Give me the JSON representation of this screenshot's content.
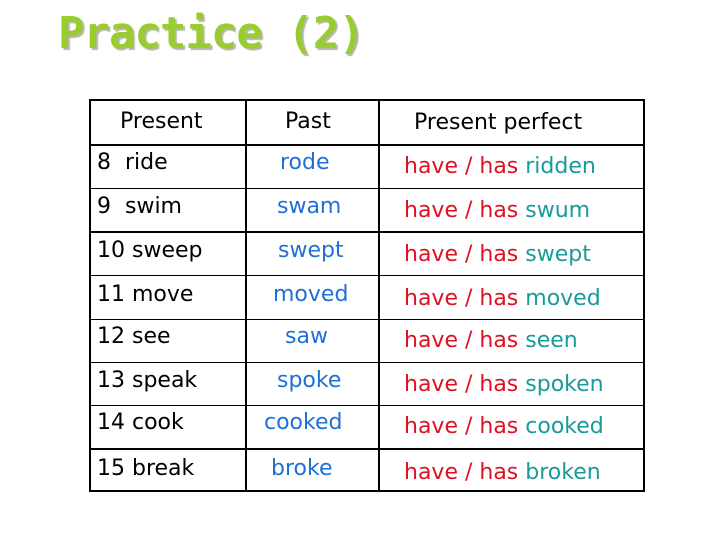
{
  "title": "Practice (2)",
  "table": {
    "headers": {
      "present": "Present",
      "past": "Past",
      "present_perfect": "Present perfect"
    },
    "rows": [
      {
        "present": "8  ride",
        "past": "rode",
        "aux": "have / has",
        "participle": "ridden"
      },
      {
        "present": "9  swim",
        "past": "swam",
        "aux": "have / has",
        "participle": "swum"
      },
      {
        "present": "10 sweep",
        "past": "swept",
        "aux": "have / has",
        "participle": "swept"
      },
      {
        "present": "11 move",
        "past": "moved",
        "aux": "have / has",
        "participle": "moved"
      },
      {
        "present": "12 see",
        "past": "saw",
        "aux": "have / has",
        "participle": "seen"
      },
      {
        "present": "13 speak",
        "past": "spoke",
        "aux": "have / has",
        "participle": "spoken"
      },
      {
        "present": "14 cook",
        "past": "cooked",
        "aux": "have / has",
        "participle": "cooked"
      },
      {
        "present": "15 break",
        "past": "broke",
        "aux": "have / has",
        "participle": "broken"
      }
    ]
  },
  "colors": {
    "title": "#99cc2e",
    "past": "#1f6fd6",
    "auxiliary": "#dd1122",
    "participle": "#1a9a9a"
  }
}
